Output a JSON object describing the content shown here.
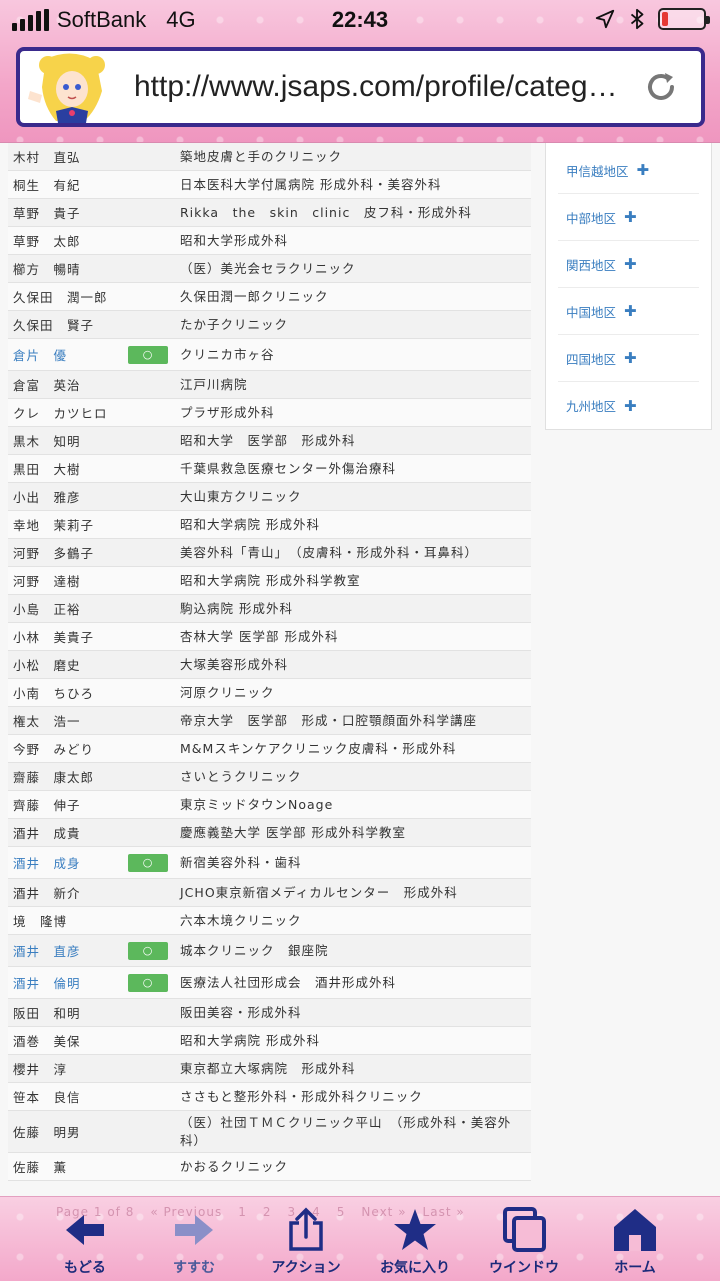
{
  "status_bar": {
    "carrier": "SoftBank",
    "network": "4G",
    "time": "22:43",
    "battery_level": 0.15,
    "battery_color": "#e53935"
  },
  "browser": {
    "url": "http://www.jsaps.com/profile/category",
    "url_suffix": "…",
    "reload_icon": "reload-icon",
    "avatar_icon": "sailor-moon-avatar"
  },
  "members": [
    {
      "name": "木村　直弘",
      "inst": "築地皮膚と手のクリニック",
      "link": false,
      "badge": false
    },
    {
      "name": "桐生　有紀",
      "inst": "日本医科大学付属病院 形成外科・美容外科",
      "link": false,
      "badge": false
    },
    {
      "name": "草野　貴子",
      "inst": "Rikka　the　skin　clinic　皮フ科・形成外科",
      "link": false,
      "badge": false
    },
    {
      "name": "草野　太郎",
      "inst": "昭和大学形成外科",
      "link": false,
      "badge": false
    },
    {
      "name": "櫛方　暢晴",
      "inst": "（医）美光会セラクリニック",
      "link": false,
      "badge": false
    },
    {
      "name": "久保田　潤一郎",
      "inst": "久保田潤一郎クリニック",
      "link": false,
      "badge": false
    },
    {
      "name": "久保田　賢子",
      "inst": "たか子クリニック",
      "link": false,
      "badge": false
    },
    {
      "name": "倉片　優",
      "inst": "クリニカ市ヶ谷",
      "link": true,
      "badge": true
    },
    {
      "name": "倉富　英治",
      "inst": "江戸川病院",
      "link": false,
      "badge": false
    },
    {
      "name": "クレ　カツヒロ",
      "inst": "プラザ形成外科",
      "link": false,
      "badge": false
    },
    {
      "name": "黒木　知明",
      "inst": "昭和大学　医学部　形成外科",
      "link": false,
      "badge": false
    },
    {
      "name": "黒田　大樹",
      "inst": "千葉県救急医療センター外傷治療科",
      "link": false,
      "badge": false
    },
    {
      "name": "小出　雅彦",
      "inst": "大山東方クリニック",
      "link": false,
      "badge": false
    },
    {
      "name": "幸地　茉莉子",
      "inst": "昭和大学病院 形成外科",
      "link": false,
      "badge": false
    },
    {
      "name": "河野　多鶴子",
      "inst": "美容外科「青山」　（皮膚科・形成外科・耳鼻科）",
      "link": false,
      "badge": false
    },
    {
      "name": "河野　達樹",
      "inst": "昭和大学病院 形成外科学教室",
      "link": false,
      "badge": false
    },
    {
      "name": "小島　正裕",
      "inst": "駒込病院 形成外科",
      "link": false,
      "badge": false
    },
    {
      "name": "小林　美貴子",
      "inst": "杏林大学 医学部 形成外科",
      "link": false,
      "badge": false
    },
    {
      "name": "小松　磨史",
      "inst": "大塚美容形成外科",
      "link": false,
      "badge": false
    },
    {
      "name": "小南　ちひろ",
      "inst": "河原クリニック",
      "link": false,
      "badge": false
    },
    {
      "name": "権太　浩一",
      "inst": "帝京大学　医学部　形成・口腔顎顔面外科学講座",
      "link": false,
      "badge": false
    },
    {
      "name": "今野　みどり",
      "inst": "M&Mスキンケアクリニック皮膚科・形成外科",
      "link": false,
      "badge": false
    },
    {
      "name": "齋藤　康太郎",
      "inst": "さいとうクリニック",
      "link": false,
      "badge": false
    },
    {
      "name": "齊藤　伸子",
      "inst": "東京ミッドタウンNoage",
      "link": false,
      "badge": false
    },
    {
      "name": "酒井　成貴",
      "inst": "慶應義塾大学 医学部 形成外科学教室",
      "link": false,
      "badge": false
    },
    {
      "name": "酒井　成身",
      "inst": "新宿美容外科・歯科",
      "link": true,
      "badge": true
    },
    {
      "name": "酒井　新介",
      "inst": "JCHO東京新宿メディカルセンター　形成外科",
      "link": false,
      "badge": false
    },
    {
      "name": "境　隆博",
      "inst": "六本木境クリニック",
      "link": false,
      "badge": false
    },
    {
      "name": "酒井　直彦",
      "inst": "城本クリニック　銀座院",
      "link": true,
      "badge": true
    },
    {
      "name": "酒井　倫明",
      "inst": "医療法人社団形成会　酒井形成外科",
      "link": true,
      "badge": true
    },
    {
      "name": "阪田　和明",
      "inst": "阪田美容・形成外科",
      "link": false,
      "badge": false
    },
    {
      "name": "酒巻　美保",
      "inst": "昭和大学病院 形成外科",
      "link": false,
      "badge": false
    },
    {
      "name": "櫻井　淳",
      "inst": "東京都立大塚病院　形成外科",
      "link": false,
      "badge": false
    },
    {
      "name": "笹本　良信",
      "inst": "ささもと整形外科・形成外科クリニック",
      "link": false,
      "badge": false
    },
    {
      "name": "佐藤　明男",
      "inst": "（医）社団ＴＭＣクリニック平山　（形成外科・美容外科）",
      "link": false,
      "badge": false
    },
    {
      "name": "佐藤　薫",
      "inst": "かおるクリニック",
      "link": false,
      "badge": false
    }
  ],
  "badge_label": "○",
  "regions": [
    {
      "label": "甲信越地区",
      "plus": "✚"
    },
    {
      "label": "中部地区",
      "plus": "✚"
    },
    {
      "label": "関西地区",
      "plus": "✚"
    },
    {
      "label": "中国地区",
      "plus": "✚"
    },
    {
      "label": "四国地区",
      "plus": "✚"
    },
    {
      "label": "九州地区",
      "plus": "✚"
    }
  ],
  "pager": [
    "Page 1 of 8",
    "« Previous",
    "1",
    "2",
    "3",
    "4",
    "5",
    "Next »",
    "Last »"
  ],
  "toolbar": {
    "back": "もどる",
    "forward": "すすむ",
    "action": "アクション",
    "favorites": "お気に入り",
    "window": "ウインドウ",
    "home": "ホーム"
  }
}
